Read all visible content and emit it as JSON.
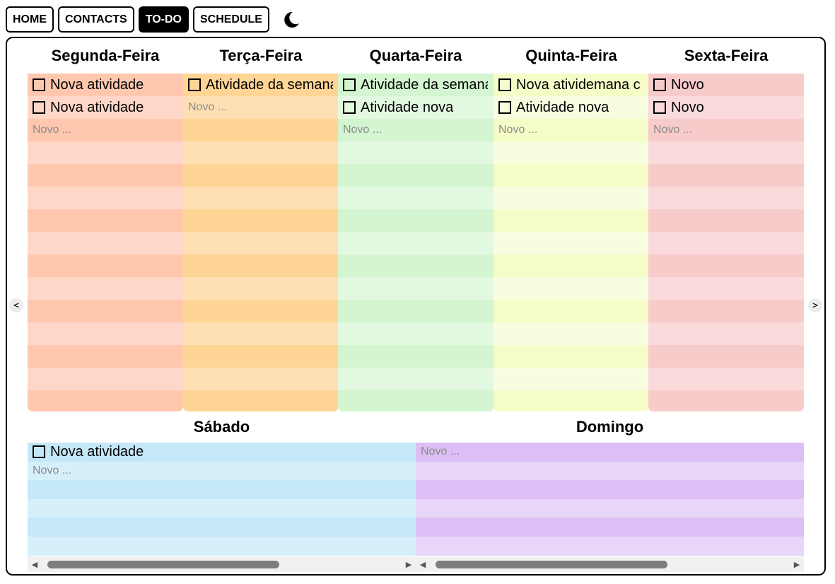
{
  "nav": {
    "items": [
      "HOME",
      "CONTACTS",
      "TO-DO",
      "SCHEDULE"
    ],
    "active": "TO-DO",
    "theme_icon": "moon-icon"
  },
  "pager": {
    "prev": "<",
    "next": ">"
  },
  "placeholder": "Novo ...",
  "weekdays": [
    {
      "title": "Segunda-Feira",
      "color_a": "#ffc8ae",
      "color_b": "#ffd7c8",
      "tasks": [
        "Nova atividade",
        "Nova atividade"
      ]
    },
    {
      "title": "Terça-Feira",
      "color_a": "#ffd596",
      "color_b": "#ffe0b4",
      "tasks": [
        "Atividade da semana"
      ]
    },
    {
      "title": "Quarta-Feira",
      "color_a": "#d3f5d0",
      "color_b": "#e3f8e0",
      "tasks": [
        "Atividade da semana",
        "Atividade nova"
      ]
    },
    {
      "title": "Quinta-Feira",
      "color_a": "#f6fcc8",
      "color_b": "#f9fde0",
      "tasks": [
        "Nova atividemana c",
        "Atividade nova"
      ]
    },
    {
      "title": "Sexta-Feira",
      "color_a": "#f8cbcb",
      "color_b": "#fadadb",
      "tasks": [
        "Novo",
        "Novo"
      ]
    }
  ],
  "weekend": [
    {
      "title": "Sábado",
      "color_a": "#c4e8f8",
      "color_b": "#d6f0fb",
      "tasks": [
        "Nova atividade"
      ]
    },
    {
      "title": "Domingo",
      "color_a": "#ddbff6",
      "color_b": "#e8d6f9",
      "tasks": []
    }
  ],
  "scroll": {
    "left_arrow": "◀",
    "right_arrow": "▶",
    "sabado_position": 0.0,
    "domingo_position": 0.0
  }
}
